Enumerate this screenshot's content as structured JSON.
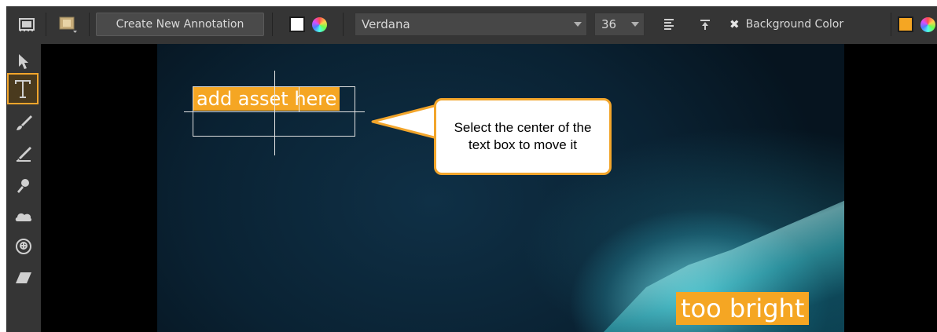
{
  "toolbar": {
    "create_annotation_label": "Create New Annotation",
    "text_color": "#ffffff",
    "font_family_value": "Verdana",
    "font_size_value": "36",
    "background_color_label": "Background Color",
    "background_color": "#f5a623"
  },
  "tools": [
    "select-arrow",
    "text",
    "brush",
    "pen",
    "magnify",
    "cloud-shape",
    "clone-stamp",
    "eraser"
  ],
  "icons": {
    "filmstrip": "filmstrip-icon",
    "box": "box-icon",
    "align": "align-left-icon",
    "valign": "align-top-icon",
    "close_x": "x-icon"
  },
  "canvas": {
    "annotation_text": "add asset here",
    "callout_text": "Select the center of the text box to move it",
    "label_text": "too bright"
  },
  "colors": {
    "accent": "#f2a52b",
    "annotation_bg": "#f5a623"
  }
}
